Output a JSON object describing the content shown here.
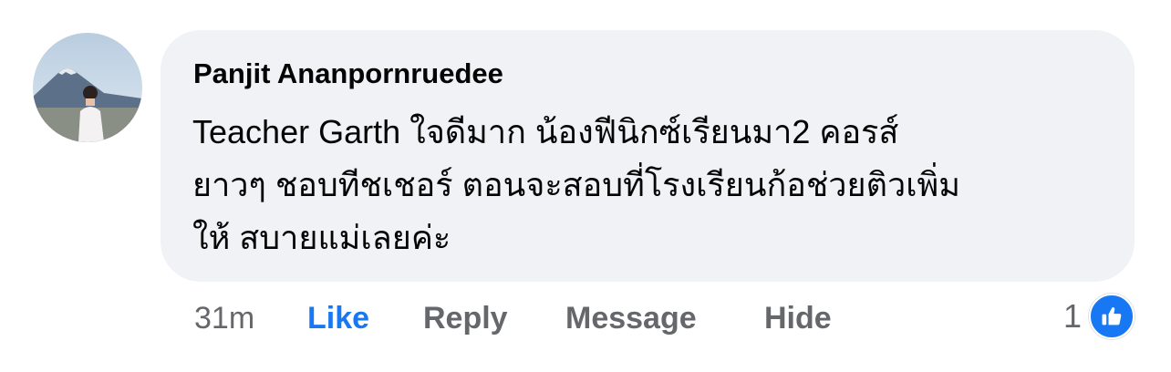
{
  "comment": {
    "author": "Panjit Ananpornruedee",
    "text_lines": [
      "Teacher Garth ใจดีมาก น้องฟีนิกซ์เรียนมา2 คอรส์",
      "ยาวๆ ชอบทีชเชอร์ ตอนจะสอบที่โรงเรียนก้อช่วยติวเพิ่ม",
      "ให้ สบายแม่เลยค่ะ"
    ],
    "avatar_icon": "profile-photo"
  },
  "actions": {
    "time": "31m",
    "like": "Like",
    "reply": "Reply",
    "message": "Message",
    "hide": "Hide"
  },
  "reactions": {
    "count": "1",
    "icon": "like-thumb-icon"
  },
  "colors": {
    "bubble_bg": "#f0f2f5",
    "like_blue": "#1877f2",
    "secondary_text": "#65676b",
    "primary_text": "#050505"
  }
}
